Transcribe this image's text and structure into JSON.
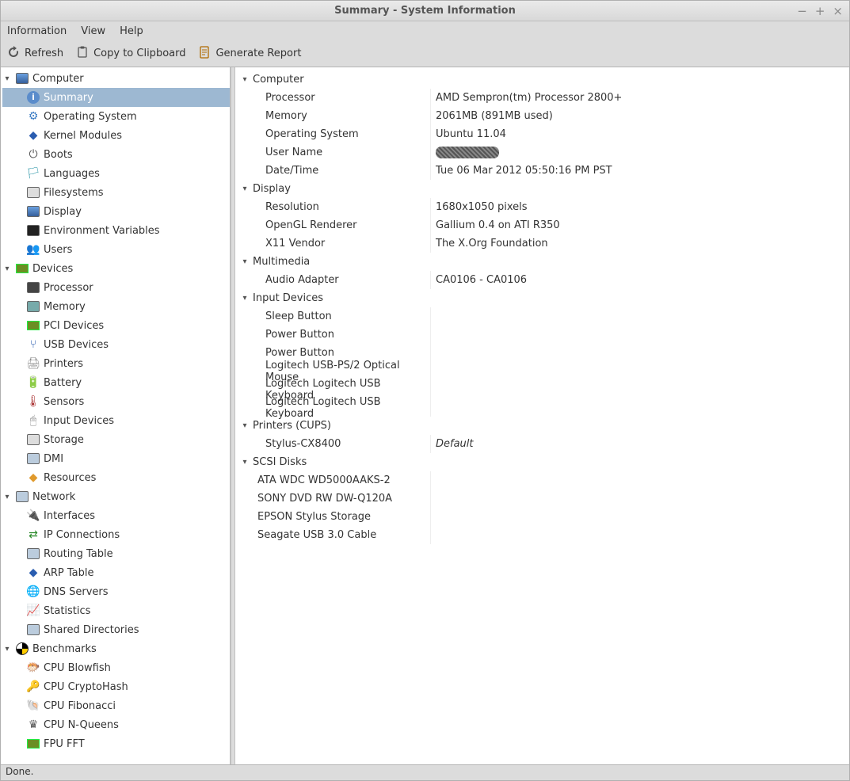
{
  "title": "Summary - System Information",
  "menus": {
    "info": "Information",
    "view": "View",
    "help": "Help"
  },
  "toolbar": {
    "refresh": "Refresh",
    "copy": "Copy to Clipboard",
    "report": "Generate Report"
  },
  "statusbar": "Done.",
  "sidebar": [
    {
      "label": "Computer",
      "icon": "computer-icon",
      "children": [
        {
          "label": "Summary",
          "icon": "info-icon",
          "selected": true
        },
        {
          "label": "Operating System",
          "icon": "gear-icon"
        },
        {
          "label": "Kernel Modules",
          "icon": "module-icon"
        },
        {
          "label": "Boots",
          "icon": "power-icon"
        },
        {
          "label": "Languages",
          "icon": "languages-icon"
        },
        {
          "label": "Filesystems",
          "icon": "drive-icon"
        },
        {
          "label": "Display",
          "icon": "display-icon"
        },
        {
          "label": "Environment Variables",
          "icon": "terminal-icon"
        },
        {
          "label": "Users",
          "icon": "users-icon"
        }
      ]
    },
    {
      "label": "Devices",
      "icon": "devices-icon",
      "children": [
        {
          "label": "Processor",
          "icon": "cpu-icon"
        },
        {
          "label": "Memory",
          "icon": "memory-icon"
        },
        {
          "label": "PCI Devices",
          "icon": "pci-icon"
        },
        {
          "label": "USB Devices",
          "icon": "usb-icon"
        },
        {
          "label": "Printers",
          "icon": "printer-icon"
        },
        {
          "label": "Battery",
          "icon": "battery-icon"
        },
        {
          "label": "Sensors",
          "icon": "sensors-icon"
        },
        {
          "label": "Input Devices",
          "icon": "input-icon"
        },
        {
          "label": "Storage",
          "icon": "storage-icon"
        },
        {
          "label": "DMI",
          "icon": "dmi-icon"
        },
        {
          "label": "Resources",
          "icon": "resources-icon"
        }
      ]
    },
    {
      "label": "Network",
      "icon": "network-icon",
      "children": [
        {
          "label": "Interfaces",
          "icon": "interfaces-icon"
        },
        {
          "label": "IP Connections",
          "icon": "ip-icon"
        },
        {
          "label": "Routing Table",
          "icon": "routing-icon"
        },
        {
          "label": "ARP Table",
          "icon": "arp-icon"
        },
        {
          "label": "DNS Servers",
          "icon": "dns-icon"
        },
        {
          "label": "Statistics",
          "icon": "stats-icon"
        },
        {
          "label": "Shared Directories",
          "icon": "shared-icon"
        }
      ]
    },
    {
      "label": "Benchmarks",
      "icon": "benchmarks-icon",
      "children": [
        {
          "label": "CPU Blowfish",
          "icon": "blowfish-icon"
        },
        {
          "label": "CPU CryptoHash",
          "icon": "crypto-icon"
        },
        {
          "label": "CPU Fibonacci",
          "icon": "fib-icon"
        },
        {
          "label": "CPU N-Queens",
          "icon": "queens-icon"
        },
        {
          "label": "FPU FFT",
          "icon": "fft-icon"
        }
      ]
    }
  ],
  "detail": [
    {
      "header": "Computer",
      "rows": [
        {
          "k": "Processor",
          "v": "AMD Sempron(tm) Processor 2800+"
        },
        {
          "k": "Memory",
          "v": "2061MB (891MB used)"
        },
        {
          "k": "Operating System",
          "v": "Ubuntu 11.04"
        },
        {
          "k": "User Name",
          "v": "[redacted]",
          "redacted": true
        },
        {
          "k": "Date/Time",
          "v": "Tue 06 Mar 2012 05:50:16 PM PST"
        }
      ]
    },
    {
      "header": "Display",
      "rows": [
        {
          "k": "Resolution",
          "v": "1680x1050 pixels"
        },
        {
          "k": "OpenGL Renderer",
          "v": "Gallium 0.4 on ATI R350"
        },
        {
          "k": "X11 Vendor",
          "v": "The X.Org Foundation"
        }
      ]
    },
    {
      "header": "Multimedia",
      "rows": [
        {
          "k": "Audio Adapter",
          "v": "CA0106 - CA0106"
        }
      ]
    },
    {
      "header": "Input Devices",
      "rows": [
        {
          "k": "Sleep Button",
          "v": ""
        },
        {
          "k": "Power Button",
          "v": ""
        },
        {
          "k": "Power Button",
          "v": ""
        },
        {
          "k": "Logitech USB-PS/2 Optical Mouse",
          "v": ""
        },
        {
          "k": "Logitech Logitech USB Keyboard",
          "v": ""
        },
        {
          "k": "Logitech Logitech USB Keyboard",
          "v": ""
        }
      ]
    },
    {
      "header": "Printers (CUPS)",
      "rows": [
        {
          "k": "Stylus-CX8400",
          "v": "Default",
          "italic": true
        }
      ]
    },
    {
      "header": "SCSI Disks",
      "rows": [
        {
          "k": "ATA WDC WD5000AAKS-2",
          "v": "",
          "indent": "shallow"
        },
        {
          "k": "SONY DVD RW DW-Q120A",
          "v": "",
          "indent": "shallow"
        },
        {
          "k": "EPSON Stylus Storage",
          "v": "",
          "indent": "shallow"
        },
        {
          "k": "Seagate USB 3.0 Cable",
          "v": "",
          "indent": "shallow"
        }
      ]
    }
  ]
}
